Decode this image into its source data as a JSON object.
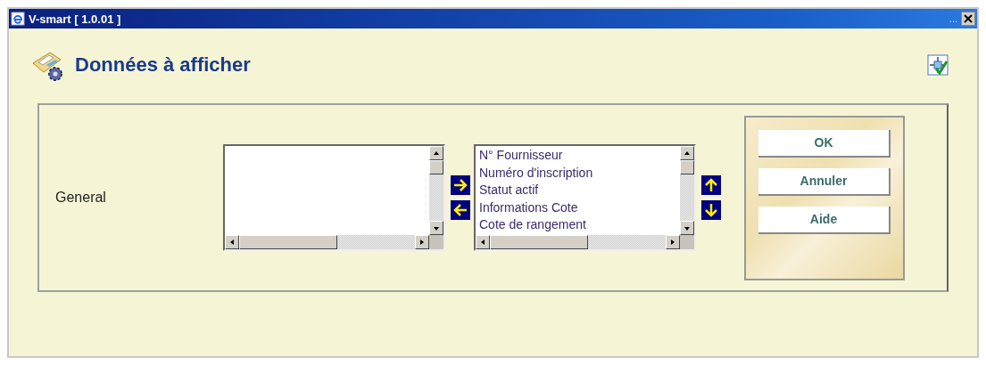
{
  "window": {
    "title": "V-smart [ 1.0.01 ]",
    "title_extra": "..."
  },
  "heading": "Données à afficher",
  "section_label": "General",
  "selected_items": [
    "N° Fournisseur",
    "Numéro d'inscription",
    "Statut actif",
    "Informations Cote",
    "Cote de rangement"
  ],
  "buttons": [
    {
      "label": "OK"
    },
    {
      "label": "Annuler"
    },
    {
      "label": "Aide"
    }
  ]
}
